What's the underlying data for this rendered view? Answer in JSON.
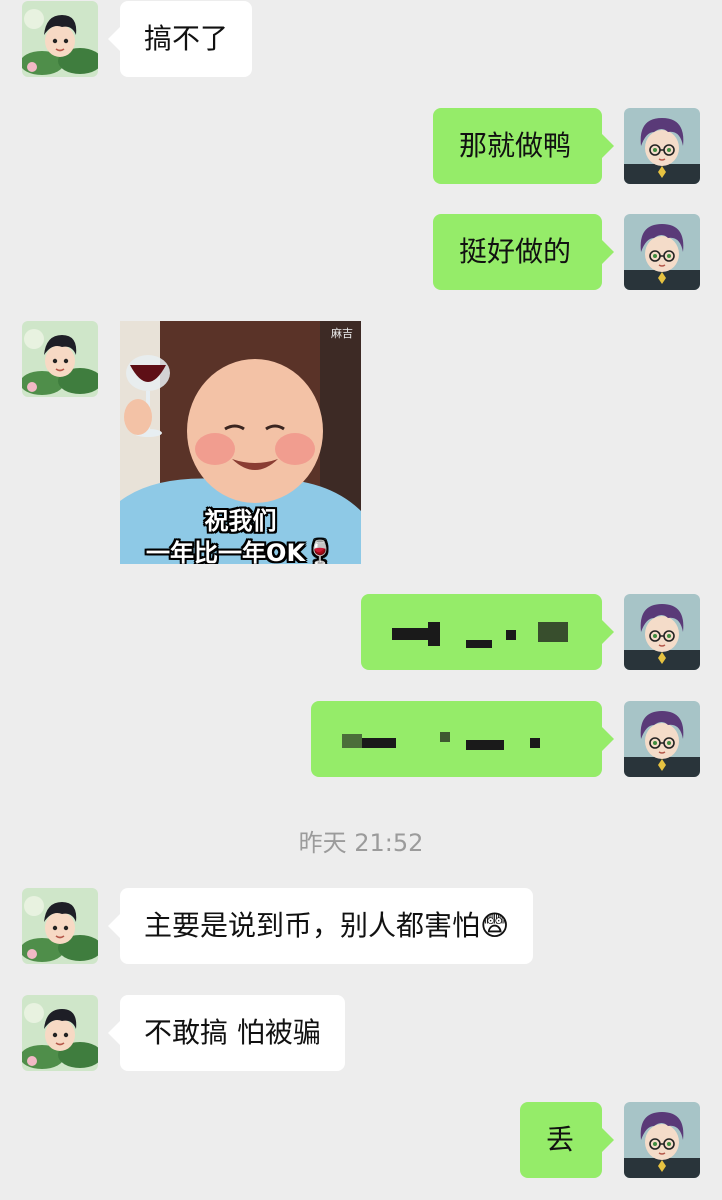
{
  "colors": {
    "background": "#ededed",
    "incoming_bubble": "#ffffff",
    "outgoing_bubble": "#95ec69",
    "timestamp_text": "#9b9b9b"
  },
  "messages": [
    {
      "sender": "other",
      "type": "text",
      "text": "搞不了"
    },
    {
      "sender": "me",
      "type": "text",
      "text": "那就做鸭"
    },
    {
      "sender": "me",
      "type": "text",
      "text": "挺好做的"
    },
    {
      "sender": "other",
      "type": "sticker",
      "caption_line1": "祝我们",
      "caption_line2": "一年比一年OK🍷",
      "watermark": "麻吉"
    },
    {
      "sender": "me",
      "type": "text",
      "text": "",
      "pixelated": true
    },
    {
      "sender": "me",
      "type": "text",
      "text": "",
      "pixelated": true
    },
    {
      "sender": "other",
      "type": "text",
      "text": "主要是说到币，别人都害怕😨"
    },
    {
      "sender": "other",
      "type": "text",
      "text": "不敢搞 怕被骗"
    },
    {
      "sender": "me",
      "type": "text",
      "text": "丢"
    }
  ],
  "timestamp": "昨天 21:52",
  "icons": {
    "other_avatar": "cartoon-boy-with-lotus-leaf-avatar",
    "my_avatar": "cartoon-purple-hair-boy-with-glasses-avatar"
  }
}
